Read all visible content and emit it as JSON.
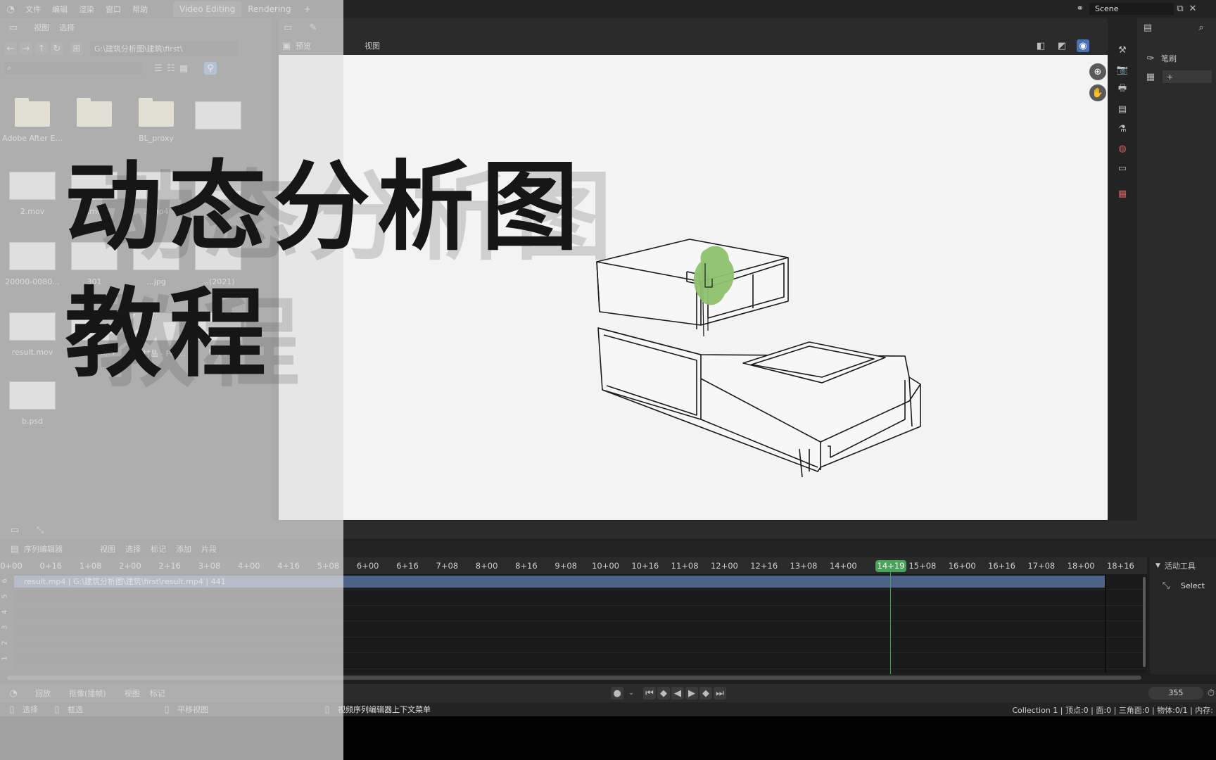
{
  "topbar": {
    "menus": [
      "文件",
      "编辑",
      "渲染",
      "窗口",
      "帮助"
    ],
    "workspace_tabs": [
      "Video Editing",
      "Rendering"
    ],
    "scene_name": "Scene"
  },
  "file_browser": {
    "menus": [
      "视图",
      "选择"
    ],
    "path": "G:\\建筑分析图\\建筑\\first\\",
    "files": [
      {
        "name": "Adobe After E...",
        "kind": "folder"
      },
      {
        "name": "",
        "kind": "folder"
      },
      {
        "name": "BL_proxy",
        "kind": "folder"
      },
      {
        "name": "",
        "kind": "image"
      },
      {
        "name": "2.mov",
        "kind": "video"
      },
      {
        "name": "3.mov",
        "kind": "video"
      },
      {
        "name": "...mp4",
        "kind": "video"
      },
      {
        "name": "",
        "kind": "image"
      },
      {
        "name": "20000-0080...",
        "kind": "video"
      },
      {
        "name": "301",
        "kind": "video"
      },
      {
        "name": "...jpg",
        "kind": "image"
      },
      {
        "name": "...(2021)",
        "kind": "image"
      },
      {
        "name": "result.mov",
        "kind": "video"
      },
      {
        "name": "result.mp4",
        "kind": "video"
      },
      {
        "name": "小涌村晶 - Pet...",
        "kind": "audio"
      },
      {
        "name": "b.jpg",
        "kind": "image"
      },
      {
        "name": "b.psd",
        "kind": "image"
      }
    ]
  },
  "preview_header": {
    "mode": "预览",
    "menu": "视图"
  },
  "properties": {
    "brush_label": "笔刷"
  },
  "overlay_title": {
    "line1": "动态分析图",
    "line2": "教程"
  },
  "sequencer": {
    "editor_name": "序列编辑器",
    "menus": [
      "视图",
      "选择",
      "标记",
      "添加",
      "片段"
    ],
    "ruler_ticks": [
      "0+00",
      "0+16",
      "1+08",
      "2+00",
      "2+16",
      "3+08",
      "4+00",
      "4+16",
      "5+08",
      "6+00",
      "6+16",
      "7+08",
      "8+00",
      "8+16",
      "9+08",
      "10+00",
      "10+16",
      "11+08",
      "12+00",
      "12+16",
      "13+08",
      "14+00",
      "14+19",
      "15+08",
      "16+00",
      "16+16",
      "17+08",
      "18+00",
      "18+16"
    ],
    "current_frame_label": "14+19",
    "channels": [
      "6",
      "5",
      "4",
      "3",
      "2",
      "1"
    ],
    "strip_label": "result.mp4 | G:\\建筑分析图\\建筑\\first\\result.mp4 | 441",
    "tool_panel_title": "活动工具",
    "tool_name": "Select"
  },
  "timeline": {
    "menus": [
      "回放",
      "抠像(插帧)",
      "视图",
      "标记"
    ],
    "current_frame": "355"
  },
  "status_bar": {
    "left_items": [
      "选择",
      "框选",
      "平移视图"
    ],
    "context_menu": "视频序列编辑器上下文菜单",
    "stats": "Collection 1 | 顶点:0 | 面:0 | 三角面:0 | 物体:0/1 | 内存:"
  },
  "colors": {
    "accent_green": "#4aa35a",
    "strip_blue": "#4b6388",
    "tree_green": "#8dc16b"
  }
}
